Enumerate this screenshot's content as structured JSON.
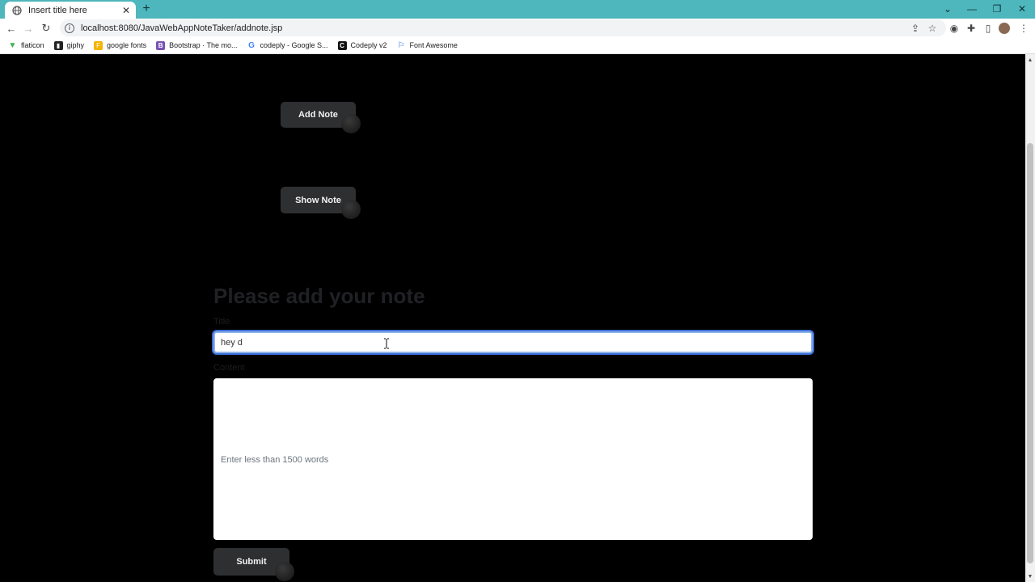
{
  "browser": {
    "tab_title": "Insert title here",
    "url": "localhost:8080/JavaWebAppNoteTaker/addnote.jsp",
    "bookmarks": [
      {
        "label": "flaticon",
        "icon": "flaticon-icon",
        "color": "#3ab54a"
      },
      {
        "label": "giphy",
        "icon": "giphy-icon",
        "color": "#222222"
      },
      {
        "label": "google fonts",
        "icon": "google-fonts-icon",
        "color": "#f4b400"
      },
      {
        "label": "Bootstrap · The mo...",
        "icon": "bootstrap-icon",
        "color": "#7952b3"
      },
      {
        "label": "codeply - Google S...",
        "icon": "google-icon",
        "color": "#ffffff"
      },
      {
        "label": "Codeply v2",
        "icon": "codeply-icon",
        "color": "#111111"
      },
      {
        "label": "Font Awesome",
        "icon": "flag-icon",
        "color": "#1c6fe3"
      }
    ]
  },
  "page": {
    "add_note_label": "Add Note",
    "show_note_label": "Show Note",
    "heading": "Please add your note",
    "title_label": "Title",
    "title_value": "hey d",
    "content_label": "Content",
    "content_placeholder": "Enter less than 1500 words",
    "submit_label": "Submit"
  },
  "colors": {
    "titlebar": "#4eb6bd",
    "page_background": "#000000",
    "button_background": "#2e2f31",
    "focus_ring": "#3c6ed8"
  }
}
